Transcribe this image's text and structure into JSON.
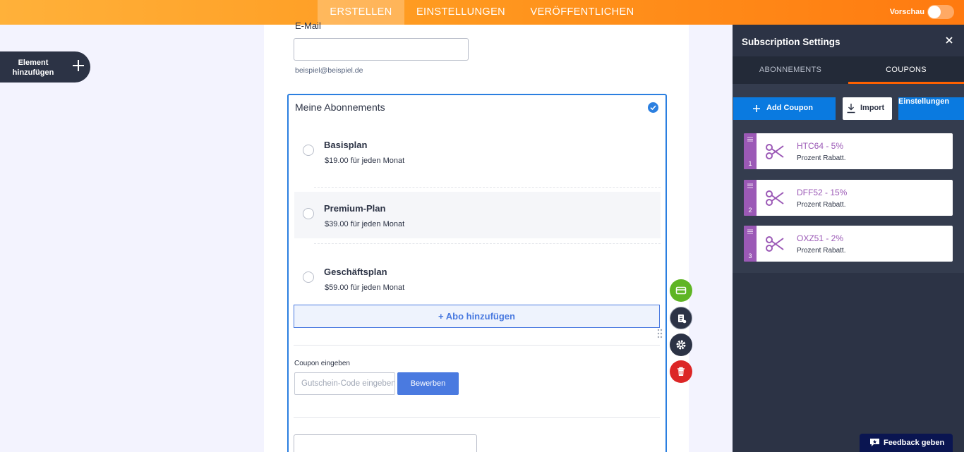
{
  "topbar": {
    "tabs": [
      {
        "label": "ERSTELLEN",
        "active": true
      },
      {
        "label": "EINSTELLUNGEN",
        "active": false
      },
      {
        "label": "VERÖFFENTLICHEN",
        "active": false
      }
    ],
    "preview_label": "Vorschau",
    "preview_enabled": false
  },
  "sidebar": {
    "add_element_label": "Element hinzufügen"
  },
  "form": {
    "email_label": "E-Mail",
    "email_value": "",
    "email_hint": "beispiel@beispiel.de",
    "product_block": {
      "title": "Meine Abonnements",
      "plans": [
        {
          "name": "Basisplan",
          "price": "$19.00 für jeden Monat"
        },
        {
          "name": "Premium-Plan",
          "price": "$39.00 für jeden Monat"
        },
        {
          "name": "Geschäftsplan",
          "price": "$59.00 für jeden Monat"
        }
      ],
      "add_plan_label": "+ Abo hinzufügen",
      "coupon_label": "Coupon eingeben",
      "coupon_placeholder": "Gutschein-Code eingeben",
      "apply_label": "Bewerben"
    }
  },
  "fab_colors": {
    "payment": "#5fb524",
    "products": "#2c3345",
    "settings": "#2c3345",
    "delete": "#dc2626"
  },
  "panel": {
    "title": "Subscription Settings",
    "tabs": [
      {
        "label": "ABONNEMENTS",
        "active": false
      },
      {
        "label": "COUPONS",
        "active": true
      }
    ],
    "buttons": {
      "add_coupon": "Add Coupon",
      "import": "Import",
      "settings": "Einstellungen"
    },
    "coupons": [
      {
        "number": "1",
        "name": "HTC64 - 5%",
        "type": "Prozent Rabatt."
      },
      {
        "number": "2",
        "name": "DFF52 - 15%",
        "type": "Prozent Rabatt."
      },
      {
        "number": "3",
        "name": "OXZ51 - 2%",
        "type": "Prozent Rabatt."
      }
    ]
  },
  "feedback_label": "Feedback geben",
  "colors": {
    "accent": "#ff6100",
    "blue": "#0a7ae0",
    "coupon_purple": "#9b59b6",
    "panel_bg": "#2c3345"
  }
}
